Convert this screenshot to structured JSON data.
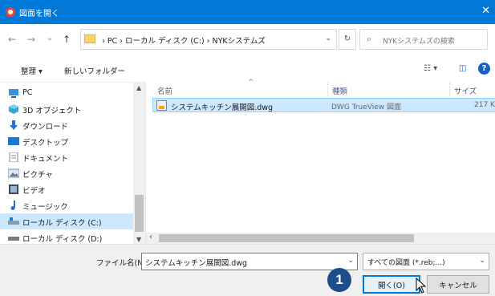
{
  "window": {
    "title": "図面を開く",
    "close_glyph": "✕"
  },
  "nav": {
    "back": "←",
    "forward": "→",
    "history": "⌄",
    "up": "↑",
    "path": "›  PC  ›  ローカル ディスク (C:)  ›  NYKシステムズ",
    "path_dropdown": "⌄",
    "refresh": "↻",
    "search_icon": "⌕",
    "search_placeholder": "NYKシステムズの検索"
  },
  "toolbar": {
    "organize": "整理 ▾",
    "new_folder": "新しいフォルダー",
    "view_icon": "☷ ▾",
    "pane_icon": "◫",
    "help": "?"
  },
  "sidebar": {
    "items": [
      {
        "label": "PC",
        "icon": "pc-icon",
        "selected": false
      },
      {
        "label": "3D オブジェクト",
        "icon": "3d-objects-icon",
        "selected": false
      },
      {
        "label": "ダウンロード",
        "icon": "download-icon",
        "selected": false
      },
      {
        "label": "デスクトップ",
        "icon": "desktop-icon",
        "selected": false
      },
      {
        "label": "ドキュメント",
        "icon": "document-icon",
        "selected": false
      },
      {
        "label": "ピクチャ",
        "icon": "pictures-icon",
        "selected": false
      },
      {
        "label": "ビデオ",
        "icon": "video-icon",
        "selected": false
      },
      {
        "label": "ミュージック",
        "icon": "music-icon",
        "selected": false
      },
      {
        "label": "ローカル ディスク (C:)",
        "icon": "drive-c-icon",
        "selected": true
      },
      {
        "label": "ローカル ディスク (D:)",
        "icon": "drive-d-icon",
        "selected": false
      }
    ],
    "scroll_up": "▲",
    "scroll_down": "▼"
  },
  "filelist": {
    "columns": {
      "name": "名前",
      "type": "種類",
      "size": "サイズ"
    },
    "sort_caret": "^",
    "rows": [
      {
        "name": "システムキッチン展開図.dwg",
        "type": "DWG TrueView 図面",
        "size": "217 K"
      }
    ],
    "scroll_left": "‹"
  },
  "bottom": {
    "filename_label": "ファイル名(N):",
    "filename_value": "システムキッチン展開図.dwg",
    "filename_dropdown": "⌄",
    "filetype_value": "すべての図面 (*.reb;...)",
    "filetype_dropdown": "⌄",
    "open_label": "開く(O)",
    "cancel_label": "キャンセル"
  },
  "annotation": {
    "step_number": "1"
  },
  "colors": {
    "titlebar": "#0078d7",
    "selection": "#cce8ff",
    "badge": "#1f4e8c"
  }
}
